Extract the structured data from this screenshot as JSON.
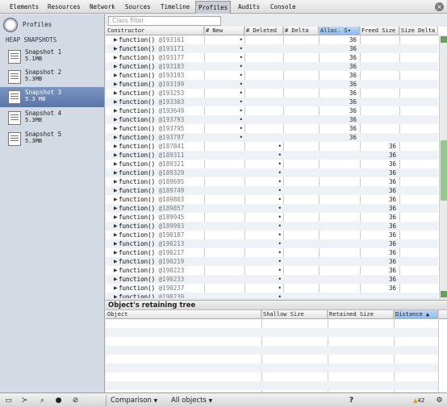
{
  "tabs": [
    "Elements",
    "Resources",
    "Network",
    "Sources",
    "Timeline",
    "Profiles",
    "Audits",
    "Console"
  ],
  "active_tab": "Profiles",
  "sidebar": {
    "title": "Profiles",
    "section": "HEAP SNAPSHOTS",
    "snapshots": [
      {
        "name": "Snapshot 1",
        "size": "5.1MB"
      },
      {
        "name": "Snapshot 2",
        "size": "5.3MB"
      },
      {
        "name": "Snapshot 3",
        "size": "5.3 MB"
      },
      {
        "name": "Snapshot 4",
        "size": "5.3MB"
      },
      {
        "name": "Snapshot 5",
        "size": "5.3MB"
      }
    ],
    "selected_index": 2
  },
  "filter_placeholder": "Class filter",
  "grid": {
    "columns": [
      "Constructor",
      "# New",
      "# Deleted",
      "# Delta",
      "Alloc. S▾",
      "Freed Size",
      "Size Delta"
    ],
    "rows": [
      {
        "name": "function()",
        "id": "@193161",
        "new": "•",
        "deleted": "",
        "alloc": "36",
        "freed": ""
      },
      {
        "name": "function()",
        "id": "@193171",
        "new": "•",
        "deleted": "",
        "alloc": "36",
        "freed": ""
      },
      {
        "name": "function()",
        "id": "@193177",
        "new": "•",
        "deleted": "",
        "alloc": "36",
        "freed": ""
      },
      {
        "name": "function()",
        "id": "@193183",
        "new": "•",
        "deleted": "",
        "alloc": "36",
        "freed": ""
      },
      {
        "name": "function()",
        "id": "@193193",
        "new": "•",
        "deleted": "",
        "alloc": "36",
        "freed": ""
      },
      {
        "name": "function()",
        "id": "@193199",
        "new": "•",
        "deleted": "",
        "alloc": "36",
        "freed": ""
      },
      {
        "name": "function()",
        "id": "@193253",
        "new": "•",
        "deleted": "",
        "alloc": "36",
        "freed": ""
      },
      {
        "name": "function()",
        "id": "@193303",
        "new": "•",
        "deleted": "",
        "alloc": "36",
        "freed": ""
      },
      {
        "name": "function()",
        "id": "@193649",
        "new": "•",
        "deleted": "",
        "alloc": "36",
        "freed": ""
      },
      {
        "name": "function()",
        "id": "@193793",
        "new": "•",
        "deleted": "",
        "alloc": "36",
        "freed": ""
      },
      {
        "name": "function()",
        "id": "@193795",
        "new": "•",
        "deleted": "",
        "alloc": "36",
        "freed": ""
      },
      {
        "name": "function()",
        "id": "@193797",
        "new": "•",
        "deleted": "",
        "alloc": "36",
        "freed": ""
      },
      {
        "name": "function()",
        "id": "@187841",
        "new": "",
        "deleted": "•",
        "alloc": "",
        "freed": "36"
      },
      {
        "name": "function()",
        "id": "@189311",
        "new": "",
        "deleted": "•",
        "alloc": "",
        "freed": "36"
      },
      {
        "name": "function()",
        "id": "@189321",
        "new": "",
        "deleted": "•",
        "alloc": "",
        "freed": "36"
      },
      {
        "name": "function()",
        "id": "@189329",
        "new": "",
        "deleted": "•",
        "alloc": "",
        "freed": "36"
      },
      {
        "name": "function()",
        "id": "@189695",
        "new": "",
        "deleted": "•",
        "alloc": "",
        "freed": "36"
      },
      {
        "name": "function()",
        "id": "@189749",
        "new": "",
        "deleted": "•",
        "alloc": "",
        "freed": "36"
      },
      {
        "name": "function()",
        "id": "@189803",
        "new": "",
        "deleted": "•",
        "alloc": "",
        "freed": "36"
      },
      {
        "name": "function()",
        "id": "@189857",
        "new": "",
        "deleted": "•",
        "alloc": "",
        "freed": "36"
      },
      {
        "name": "function()",
        "id": "@189945",
        "new": "",
        "deleted": "•",
        "alloc": "",
        "freed": "36"
      },
      {
        "name": "function()",
        "id": "@189993",
        "new": "",
        "deleted": "•",
        "alloc": "",
        "freed": "36"
      },
      {
        "name": "function()",
        "id": "@190187",
        "new": "",
        "deleted": "•",
        "alloc": "",
        "freed": "36"
      },
      {
        "name": "function()",
        "id": "@190213",
        "new": "",
        "deleted": "•",
        "alloc": "",
        "freed": "36"
      },
      {
        "name": "function()",
        "id": "@190217",
        "new": "",
        "deleted": "•",
        "alloc": "",
        "freed": "36"
      },
      {
        "name": "function()",
        "id": "@190219",
        "new": "",
        "deleted": "•",
        "alloc": "",
        "freed": "36"
      },
      {
        "name": "function()",
        "id": "@190223",
        "new": "",
        "deleted": "•",
        "alloc": "",
        "freed": "36"
      },
      {
        "name": "function()",
        "id": "@190233",
        "new": "",
        "deleted": "•",
        "alloc": "",
        "freed": "36"
      },
      {
        "name": "function()",
        "id": "@190237",
        "new": "",
        "deleted": "•",
        "alloc": "",
        "freed": "36"
      },
      {
        "name": "function()",
        "id": "@190239",
        "new": "",
        "deleted": "•",
        "alloc": "",
        "freed": ""
      }
    ]
  },
  "retaining_tree": {
    "title": "Object's retaining tree",
    "columns": [
      "Object",
      "Shallow Size",
      "Retained Size",
      "Distance ▲"
    ]
  },
  "statusbar": {
    "view_mode": "Comparison",
    "filter_mode": "All objects",
    "help": "?",
    "warning_count": "42"
  },
  "colors": {
    "selected_snapshot": "#5a76a8",
    "sorted_header": "#8eb8ea",
    "function_keyword": "#000000"
  }
}
